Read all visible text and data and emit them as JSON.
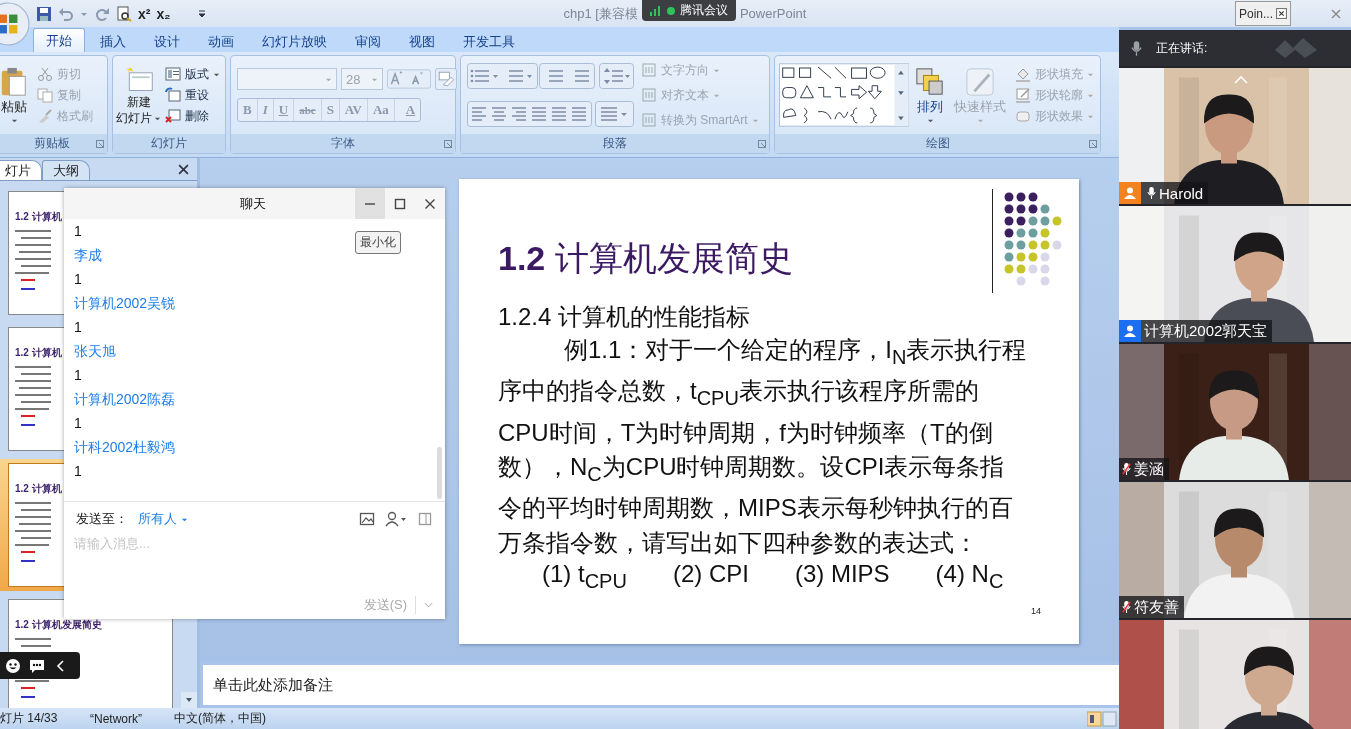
{
  "title_bar": {
    "quick_access_text": [
      "x²",
      "x₂"
    ],
    "title_start": "chp1 [兼容模",
    "meeting_badge": "腾讯会议",
    "title_end": "PowerPoint",
    "mini_window": "Poin..."
  },
  "ribbon_tabs": [
    {
      "label": "开始",
      "selected": true
    },
    {
      "label": "插入",
      "selected": false
    },
    {
      "label": "设计",
      "selected": false
    },
    {
      "label": "动画",
      "selected": false
    },
    {
      "label": "幻灯片放映",
      "selected": false
    },
    {
      "label": "审阅",
      "selected": false
    },
    {
      "label": "视图",
      "selected": false
    },
    {
      "label": "开发工具",
      "selected": false
    }
  ],
  "ribbon": {
    "clipboard": {
      "label": "剪贴板",
      "paste": "粘贴",
      "items": [
        {
          "label": "剪切",
          "disabled": true
        },
        {
          "label": "复制",
          "disabled": true
        },
        {
          "label": "格式刷",
          "disabled": true
        }
      ]
    },
    "slides": {
      "label": "幻灯片",
      "new_slide": [
        "新建",
        "幻灯片"
      ],
      "items": [
        {
          "label": "版式",
          "disabled": false
        },
        {
          "label": "重设",
          "disabled": false
        },
        {
          "label": "删除",
          "disabled": false
        }
      ]
    },
    "font": {
      "label": "字体",
      "size": "28",
      "format_buttons": [
        "B",
        "I",
        "U",
        "abc",
        "S",
        "AV",
        "Aa",
        "A"
      ]
    },
    "paragraph": {
      "label": "段落",
      "items": [
        {
          "label": "文字方向",
          "disabled": true
        },
        {
          "label": "对齐文本",
          "disabled": true
        },
        {
          "label": "转换为 SmartArt",
          "disabled": true
        }
      ]
    },
    "drawing": {
      "label": "绘图",
      "arrange": {
        "label": "排列",
        "disabled": false
      },
      "quick_styles": {
        "label": "快速样式",
        "disabled": true
      },
      "items": [
        {
          "label": "形状填充",
          "disabled": true
        },
        {
          "label": "形状轮廓",
          "disabled": true
        },
        {
          "label": "形状效果",
          "disabled": true
        }
      ]
    }
  },
  "pane_tabs": [
    {
      "label": "灯片",
      "selected": true
    },
    {
      "label": "大纲",
      "selected": false
    }
  ],
  "thumbnails": [
    {
      "title": "1.2 计算机",
      "selected": false
    },
    {
      "title": "1.2 计算机",
      "selected": false
    },
    {
      "title": "1.2 计算机",
      "selected": true
    },
    {
      "title": "1.2 计算机发展简史",
      "selected": false
    }
  ],
  "slide": {
    "title": "**1.2** 计算机发展简史",
    "subtitle": "1.2.4 计算机的性能指标",
    "body": "例1.1：对于一个给定的程序，I$_{N}$表示执行程序中的指令总数，t$_{CPU}$表示执行该程序所需的CPU时间，T为时钟周期，f为时钟频率（T的倒数），N$_{C}$为CPU时钟周期数。设CPI表示每条指令的平均时钟周期数，MIPS表示每秒钟执行的百万条指令数，请写出如下四种参数的表达式：",
    "formulas": [
      "(1) t$_{CPU}$",
      "(2) CPI",
      "(3) MIPS",
      "(4) N$_{C}$"
    ],
    "page_number": "14"
  },
  "notes_placeholder": "单击此处添加备注",
  "status_bar": [
    "灯片 14/33",
    "“Network”",
    "中文(简体，中国)"
  ],
  "chat": {
    "title": "聊天",
    "tooltip": "最小化",
    "messages": [
      {
        "text": "1"
      },
      {
        "sender": "李成",
        "text": "1"
      },
      {
        "sender": "计算机2002吴锐",
        "text": "1"
      },
      {
        "sender": "张天旭",
        "text": "1"
      },
      {
        "sender": "计算机2002陈磊",
        "text": "1"
      },
      {
        "sender": "计科2002杜毅鸿",
        "text": "1"
      }
    ],
    "send_to_label": "发送至：",
    "recipient": "所有人",
    "placeholder": "请输入消息...",
    "send_button": "发送(S)"
  },
  "meeting": {
    "speaking_label": "正在讲话:",
    "tiles": [
      {
        "kind": "video",
        "name": "Harold",
        "color": "#f58220",
        "muted": false
      },
      {
        "kind": "video",
        "name": "计算机2002郭天宝",
        "color": "#1d6ff2"
      },
      {
        "kind": "video",
        "name": "姜涵",
        "muted": true
      },
      {
        "kind": "video",
        "name": "符友善",
        "muted": true
      },
      {
        "kind": "video"
      }
    ]
  }
}
